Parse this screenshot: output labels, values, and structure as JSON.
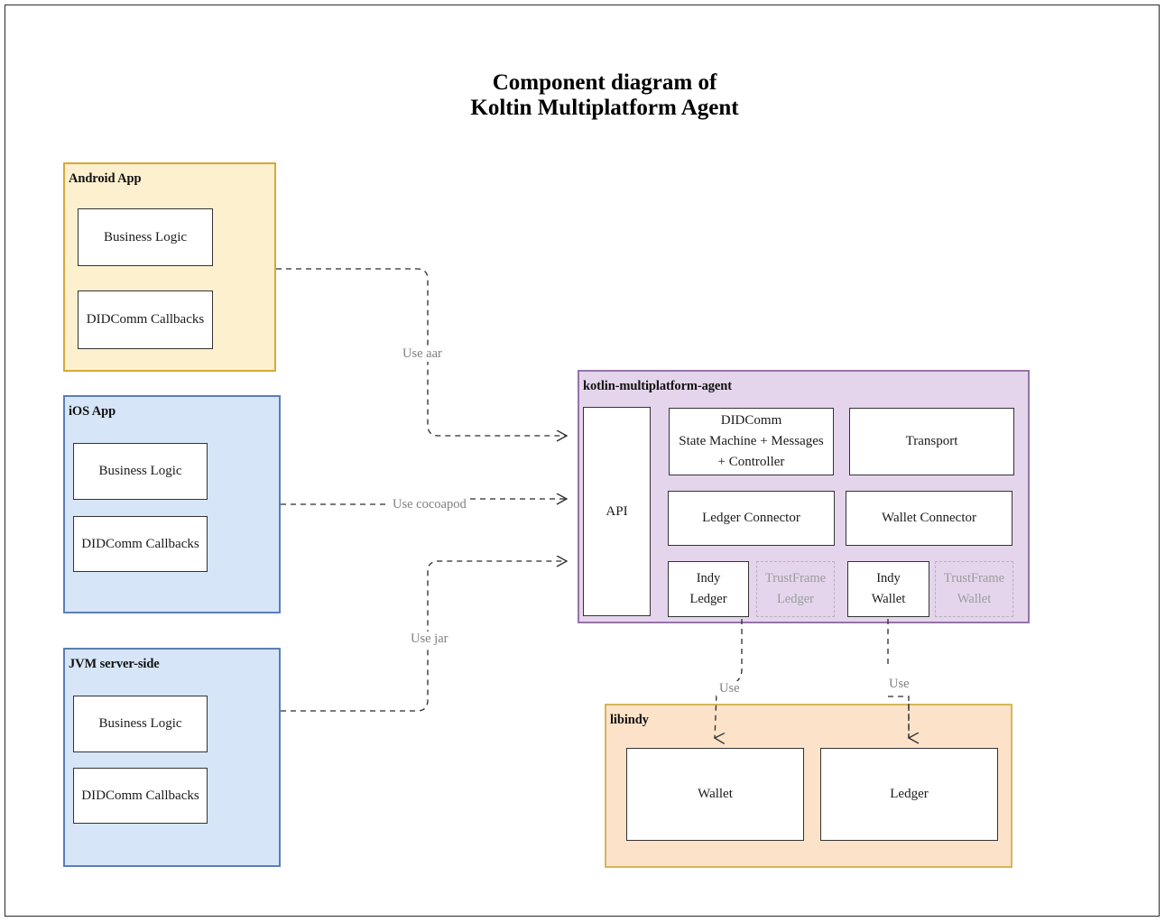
{
  "title": "Component diagram of\nKoltin Multiplatform Agent",
  "colors": {
    "android_fill": "#fdf0ce",
    "android_border": "#d6a838",
    "ios_fill": "#d6e5f8",
    "ios_border": "#5a7fb5",
    "agent_fill": "#e4d5ec",
    "agent_border": "#9673a6",
    "libindy_fill": "#fce2c8",
    "libindy_border": "#d6b656",
    "component_fill": "#ffffff",
    "component_border": "#333333",
    "ghost_border": "#b9b0bd",
    "ghost_text": "#9b9b9b",
    "edge": "#2b2b2b",
    "edge_label": "#808080"
  },
  "groups": {
    "android": {
      "title": "Android App",
      "components": [
        {
          "label": "Business Logic"
        },
        {
          "label": "DIDComm Callbacks"
        }
      ]
    },
    "ios": {
      "title": "iOS App",
      "components": [
        {
          "label": "Business Logic"
        },
        {
          "label": "DIDComm Callbacks"
        }
      ]
    },
    "jvm": {
      "title": "JVM server-side",
      "components": [
        {
          "label": "Business Logic"
        },
        {
          "label": "DIDComm Callbacks"
        }
      ]
    },
    "agent": {
      "title": "kotlin-multiplatform-agent",
      "components": [
        {
          "label": "API",
          "style": "solid"
        },
        {
          "label": "DIDComm\nState Machine + Messages\n+ Controller",
          "style": "solid"
        },
        {
          "label": "Transport",
          "style": "solid"
        },
        {
          "label": "Ledger Connector",
          "style": "solid"
        },
        {
          "label": "Wallet Connector",
          "style": "solid"
        },
        {
          "label": "Indy\nLedger",
          "style": "solid"
        },
        {
          "label": "TrustFrame\nLedger",
          "style": "dashed"
        },
        {
          "label": "Indy\nWallet",
          "style": "solid"
        },
        {
          "label": "TrustFrame\nWallet",
          "style": "dashed"
        }
      ]
    },
    "libindy": {
      "title": "libindy",
      "components": [
        {
          "label": "Wallet"
        },
        {
          "label": "Ledger"
        }
      ]
    }
  },
  "edges": [
    {
      "id": "android-to-agent",
      "label": "Use  aar",
      "from": "Android App",
      "to": "kotlin-multiplatform-agent"
    },
    {
      "id": "ios-to-agent",
      "label": "Use cocoapod",
      "from": "iOS App",
      "to": "kotlin-multiplatform-agent"
    },
    {
      "id": "jvm-to-agent",
      "label": "Use jar",
      "from": "JVM server-side",
      "to": "kotlin-multiplatform-agent"
    },
    {
      "id": "indyledger-to-wallet",
      "label": "Use",
      "from": "Indy Ledger",
      "to": "Wallet"
    },
    {
      "id": "indywallet-to-ledger",
      "label": "Use",
      "from": "Indy Wallet",
      "to": "Ledger"
    }
  ]
}
